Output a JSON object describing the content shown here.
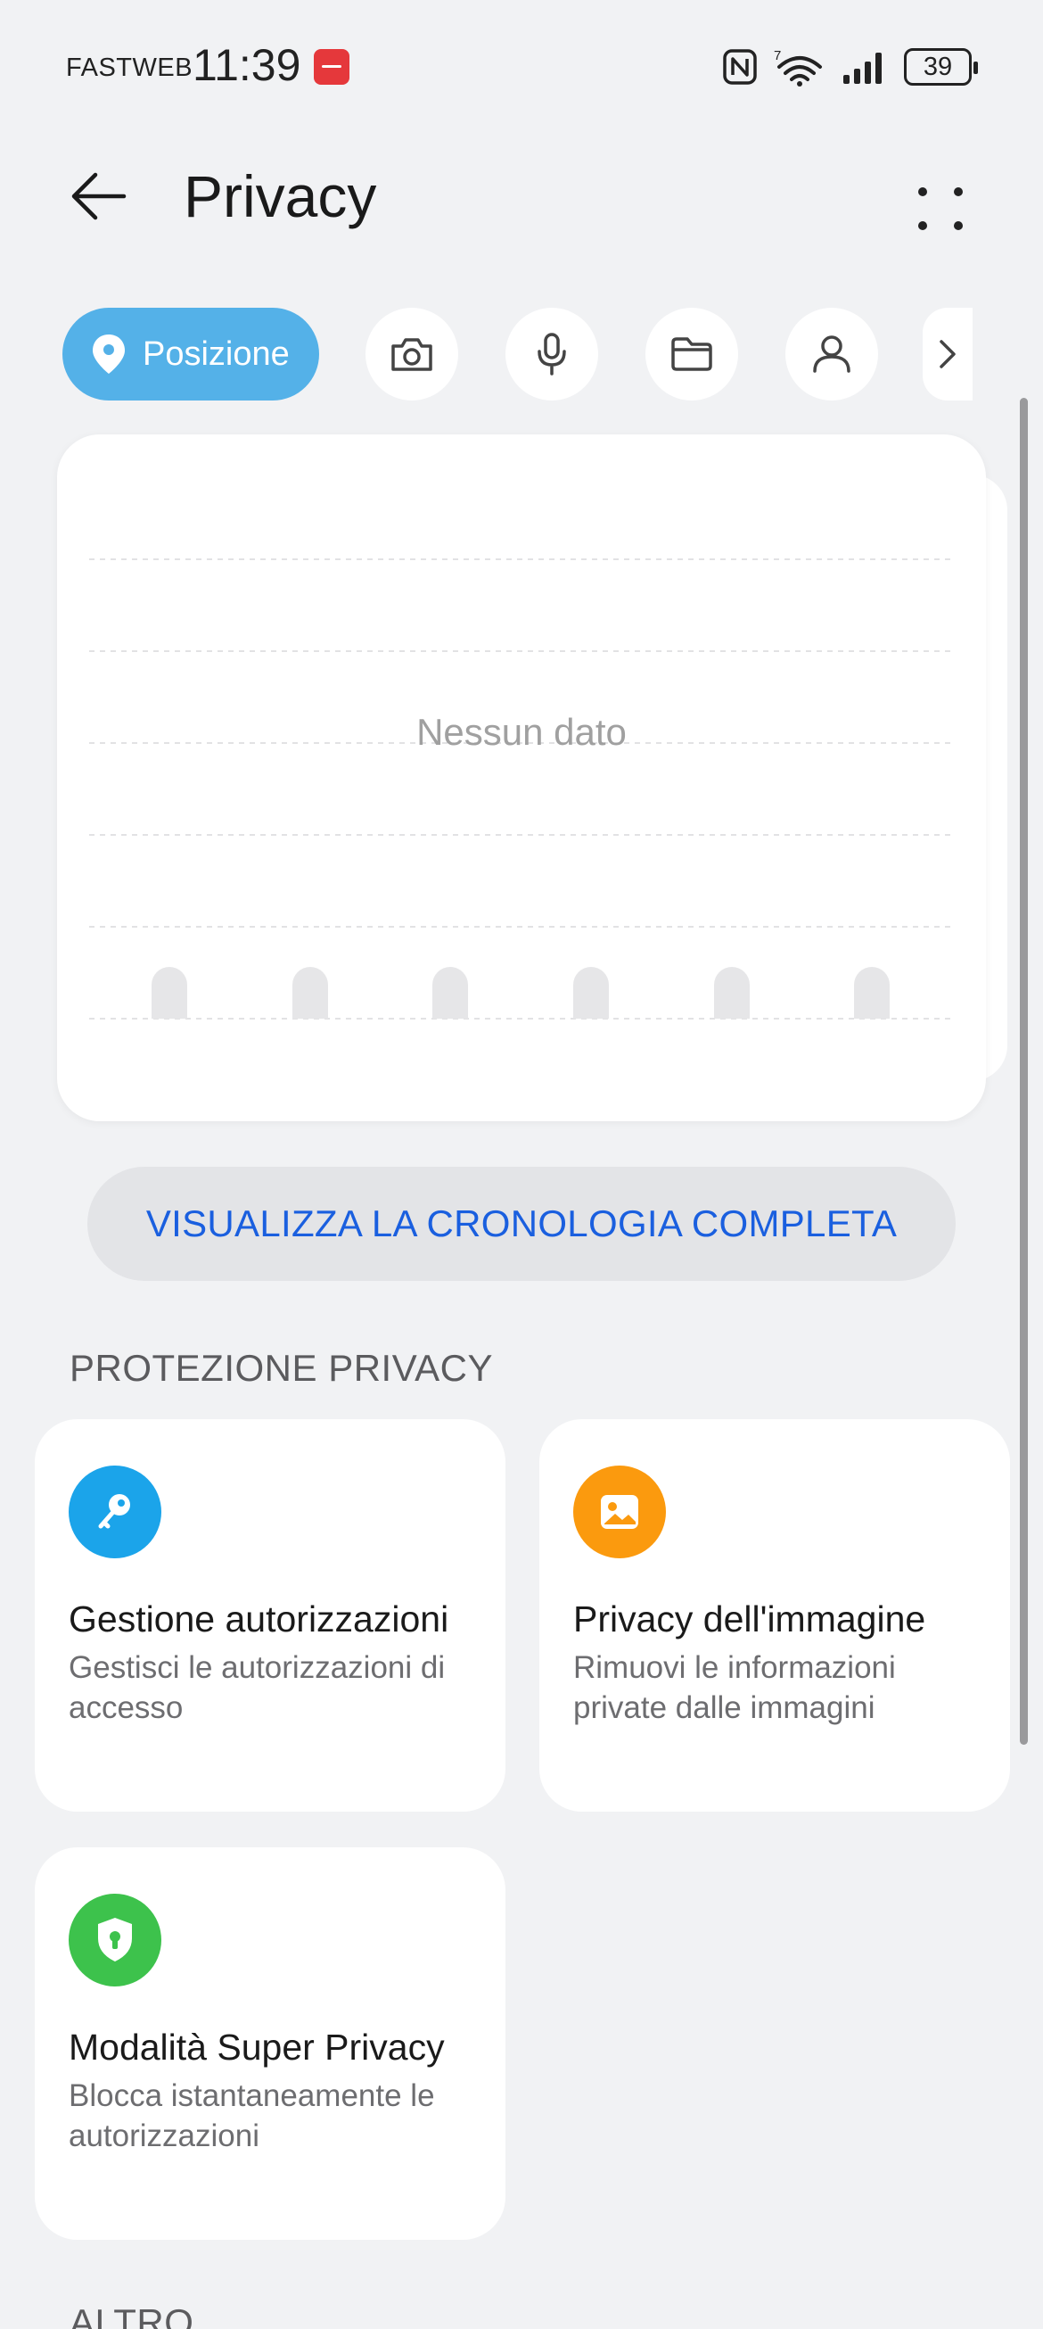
{
  "status_bar": {
    "carrier": "FASTWEB",
    "time": "11:39",
    "battery": "39"
  },
  "header": {
    "title": "Privacy"
  },
  "chips": {
    "active_label": "Posizione",
    "items": [
      "location-icon",
      "camera-icon",
      "microphone-icon",
      "folder-icon",
      "contacts-icon"
    ]
  },
  "chart": {
    "empty_text": "Nessun dato"
  },
  "history_button": {
    "label": "VISUALIZZA LA CRONOLOGIA COMPLETA"
  },
  "sections": {
    "protection_title": "PROTEZIONE PRIVACY",
    "other_title": "ALTRO"
  },
  "cards": [
    {
      "title": "Gestione autorizzazioni",
      "desc": "Gestisci le autorizzazioni di accesso",
      "icon": "key-icon",
      "color": "#1ba4ea"
    },
    {
      "title": "Privacy dell'immagine",
      "desc": "Rimuovi le informazioni private dalle immagini",
      "icon": "image-icon",
      "color": "#fb9a0e"
    },
    {
      "title": "Modalità Super Privacy",
      "desc": "Blocca istantaneamente le autorizzazioni",
      "icon": "shield-lock-icon",
      "color": "#3dc24c"
    }
  ],
  "colors": {
    "accent_blue": "#54b1e8",
    "link_blue": "#1a5fdf",
    "background": "#f1f2f4"
  }
}
